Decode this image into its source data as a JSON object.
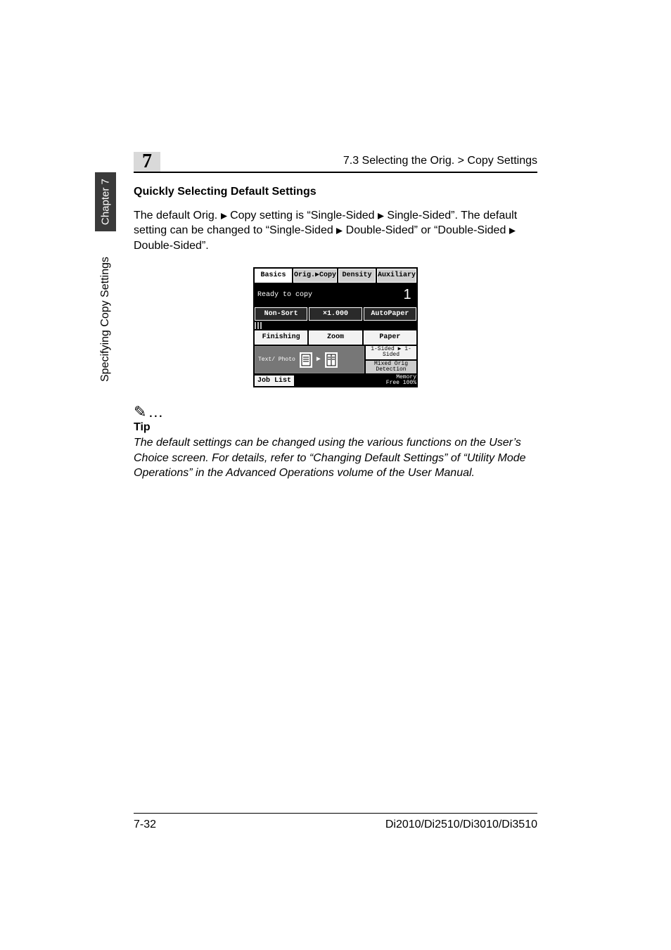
{
  "header": {
    "chapter_number": "7",
    "section": "7.3 Selecting the Orig. > Copy Settings"
  },
  "sidebar": {
    "chapter_tab": "Chapter 7",
    "vertical_label": "Specifying Copy Settings"
  },
  "content": {
    "heading": "Quickly Selecting Default Settings",
    "para_a": "The default Orig.",
    "para_b": "Copy setting is “Single-Sided",
    "para_c": "Single-Sided”. The default setting can be changed to “Single-Sided",
    "para_d": "Double-Sided” or “Double-Sided",
    "para_e": "Double-Sided”."
  },
  "lcd": {
    "tabs": {
      "basics": "Basics",
      "origcopy": "Orig.▶Copy",
      "density": "Density",
      "aux": "Auxiliary"
    },
    "status": "Ready to copy",
    "counter": "1",
    "row1": {
      "nonsort": "Non-Sort",
      "ratio": "×1.000",
      "autopaper": "AutoPaper"
    },
    "row2": {
      "finishing": "Finishing",
      "zoom": "Zoom",
      "paper": "Paper"
    },
    "orig": {
      "label": "Text/\nPhoto"
    },
    "side": {
      "s1": "1-Sided ▶\n1-Sided",
      "s2": "Mixed Orig\nDetection"
    },
    "joblist": "Job List",
    "memory_l1": "Memory",
    "memory_l2": "Free 100%"
  },
  "tip": {
    "icon": "✎…",
    "label": "Tip",
    "body": "The default settings can be changed using the various functions on the User’s Choice screen. For details, refer to “Changing Default Settings” of “Utility Mode Operations” in the Advanced Operations volume of the User Manual."
  },
  "footer": {
    "page": "7-32",
    "product": "Di2010/Di2510/Di3010/Di3510"
  }
}
